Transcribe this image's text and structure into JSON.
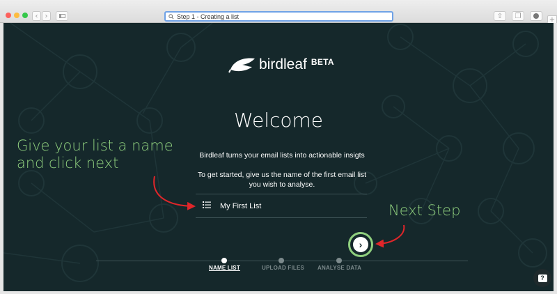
{
  "browser": {
    "tab_title": "Step 1 - Creating a list",
    "search_icon": "search-icon"
  },
  "colors": {
    "background": "#15282b",
    "accent_green": "#8fcf7e",
    "arrow_red": "#e0262a",
    "text_white": "#ffffff"
  },
  "app": {
    "logo_name": "birdleaf",
    "logo_badge": "BETA",
    "heading": "Welcome",
    "intro_line1": "Birdleaf turns your email lists into actionable insigts",
    "intro_line2": "To get started, give us the name of the first email list you wish to analyse.",
    "list_name_value": "My First List",
    "list_icon": "list-icon",
    "next_icon": "chevron-right-icon",
    "help_icon": "help-chat-icon"
  },
  "steps": [
    {
      "label": "NAME LIST",
      "active": true
    },
    {
      "label": "UPLOAD FILES",
      "active": false
    },
    {
      "label": "ANALYSE DATA",
      "active": false
    }
  ],
  "annotations": {
    "left_line1": "Give your list a name",
    "left_line2": "and click next",
    "right": "Next Step"
  }
}
